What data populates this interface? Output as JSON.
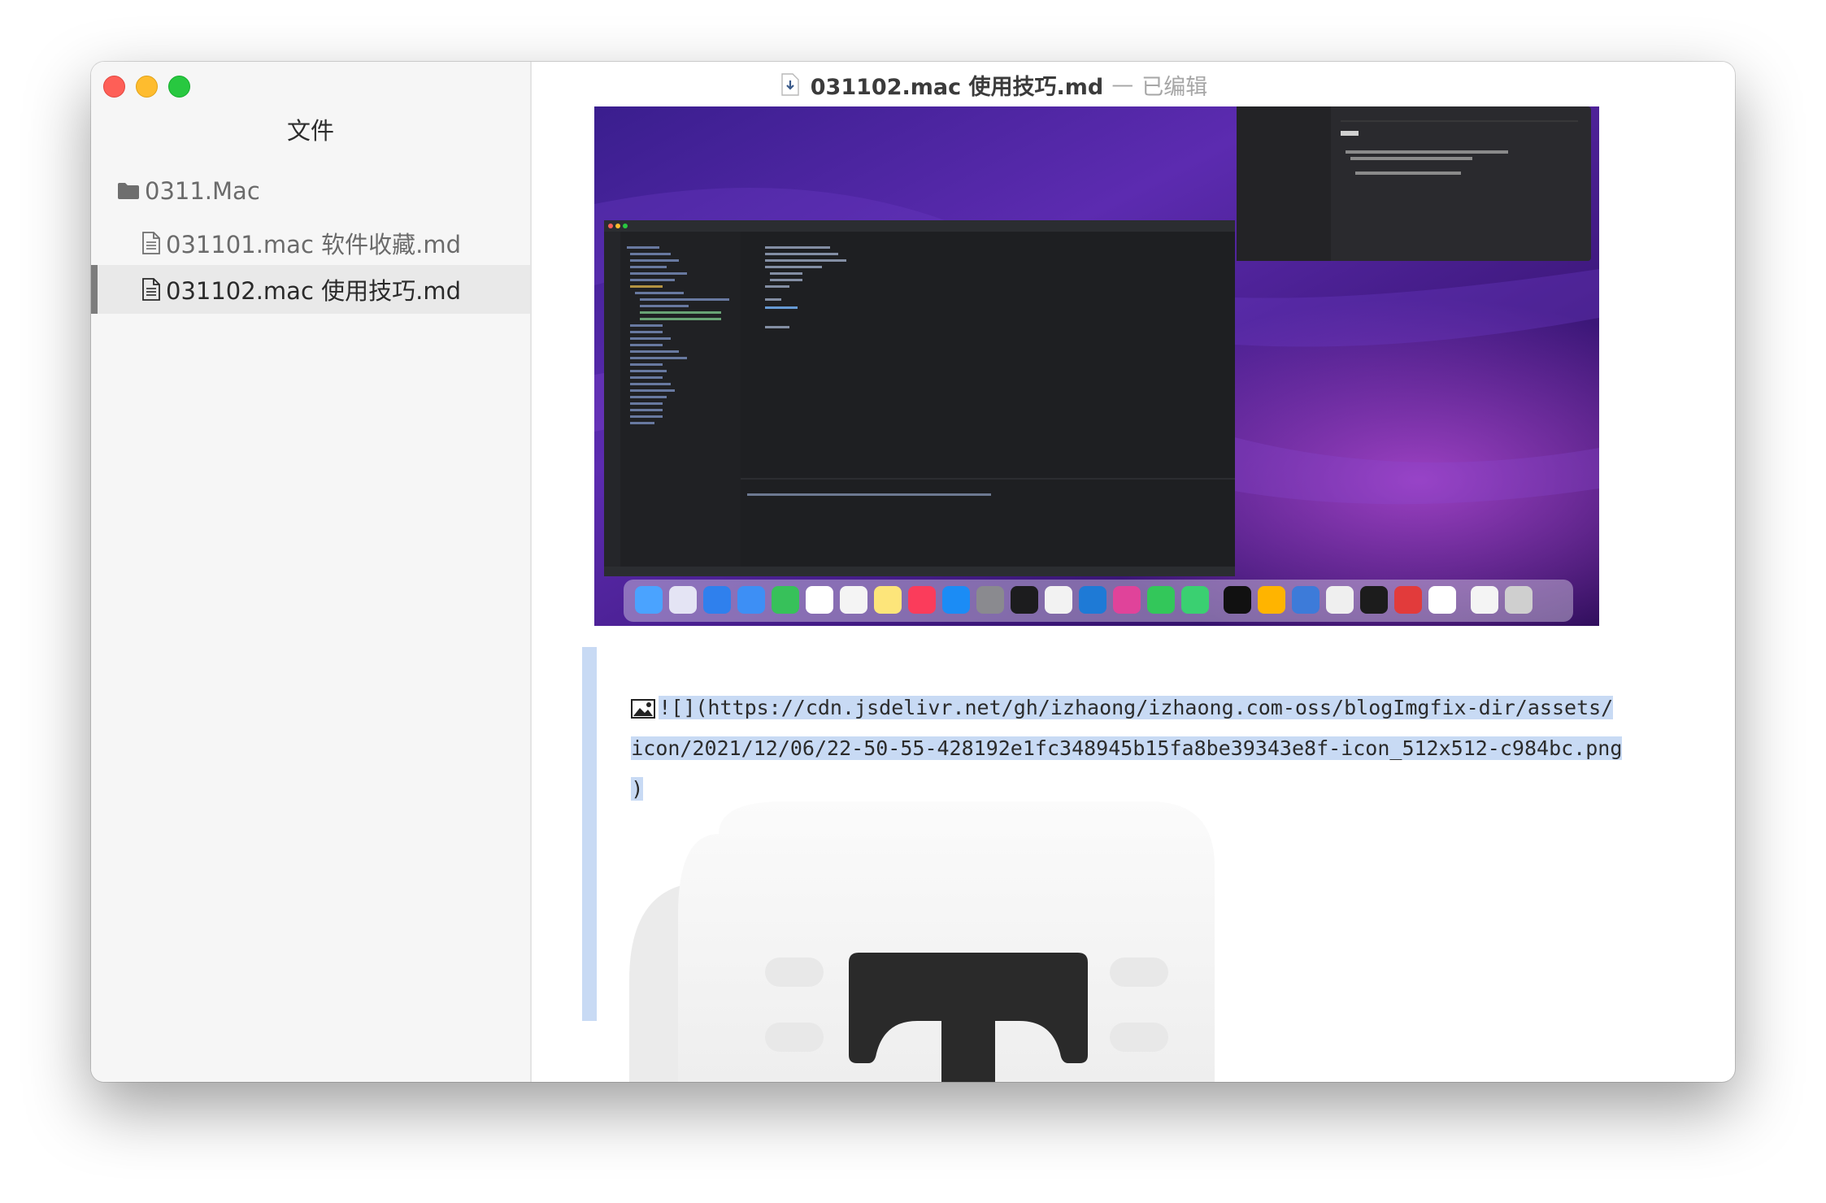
{
  "window": {
    "title_filename": "031102.mac 使用技巧.md",
    "title_separator": "—",
    "title_status": "已编辑"
  },
  "sidebar": {
    "heading": "文件",
    "folder": {
      "label": "0311.Mac",
      "icon": "folder-icon"
    },
    "files": [
      {
        "label": "031101.mac 软件收藏.md",
        "icon": "file-icon",
        "selected": false
      },
      {
        "label": "031102.mac 使用技巧.md",
        "icon": "file-icon",
        "selected": true
      }
    ]
  },
  "editor": {
    "markdown_image_line_1": "![](https://cdn.jsdelivr.net/gh/izhaong/izhaong.com-oss/blogImgfix-dir/assets/",
    "markdown_image_line_2": "icon/2021/12/06/22-50-55-428192e1fc348945b15fa8be39343e8f-icon_512x512-c984bc.png",
    "markdown_image_line_3": ")",
    "embedded_icon_letter": "T"
  },
  "colors": {
    "selection": "#c8daf4",
    "sidebar_bg": "#f6f6f6",
    "selected_row_bg": "#e9e9e9",
    "traffic_red": "#fe5f57",
    "traffic_yellow": "#febc2e",
    "traffic_green": "#28c840"
  }
}
